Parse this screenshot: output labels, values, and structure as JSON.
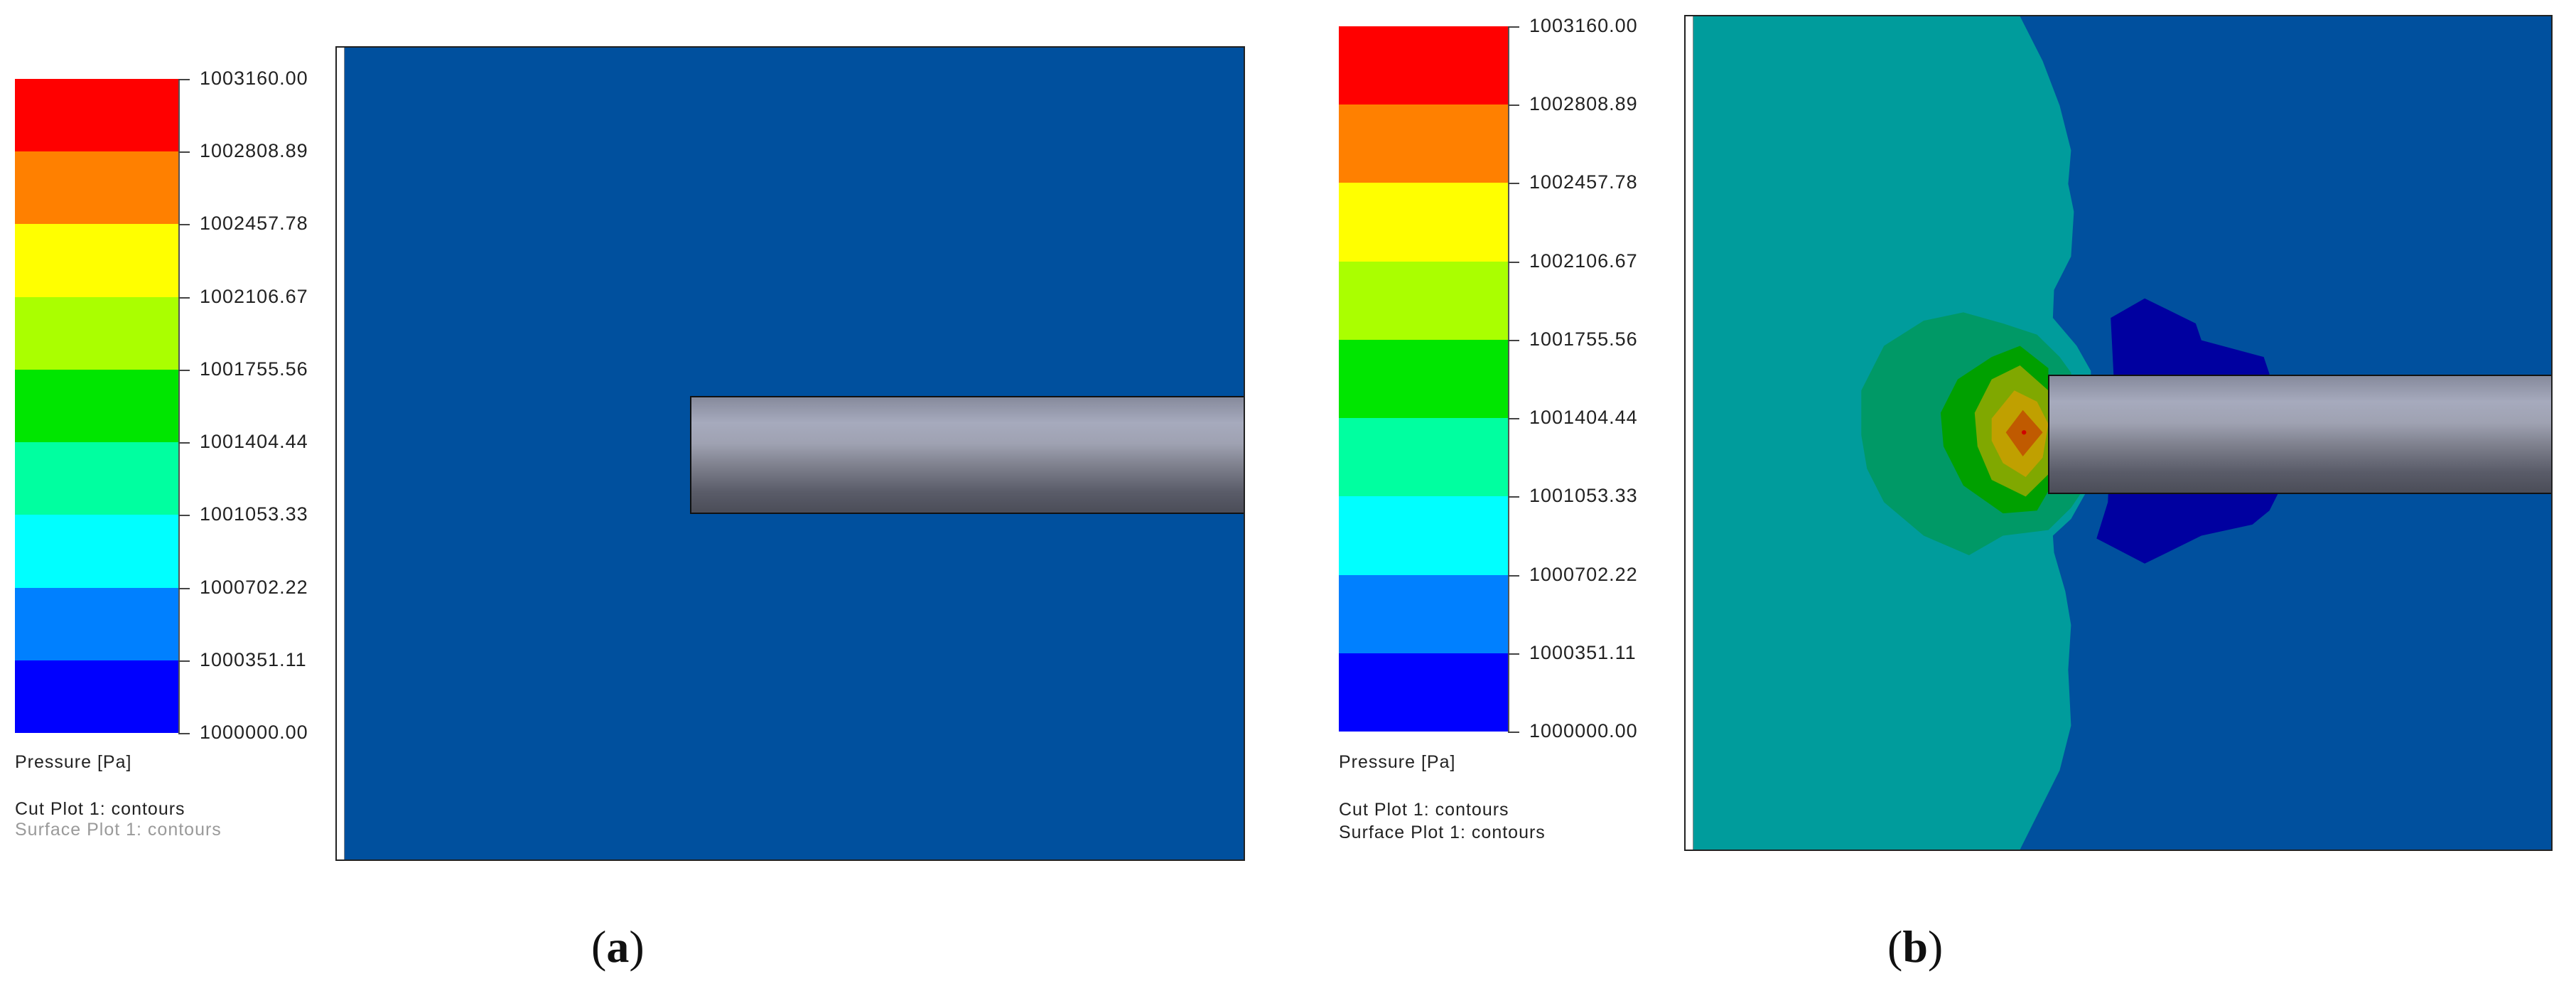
{
  "legend": {
    "colors": [
      "#ff0000",
      "#ff8000",
      "#ffff00",
      "#aaff00",
      "#00e600",
      "#00ffa0",
      "#00ffff",
      "#0080ff",
      "#0000ff"
    ],
    "ticks": [
      "1003160.00",
      "1002808.89",
      "1002457.78",
      "1002106.67",
      "1001755.56",
      "1001404.44",
      "1001053.33",
      "1000702.22",
      "1000351.11",
      "1000000.00"
    ],
    "unit_label": "Pressure [Pa]"
  },
  "panel_a": {
    "cut_plot": "Cut Plot 1: contours",
    "surface_plot": "Surface Plot 1: contours",
    "caption_open": "(",
    "caption_letter": "a",
    "caption_close": ")"
  },
  "panel_b": {
    "cut_plot": "Cut Plot 1: contours",
    "surface_plot": "Surface Plot 1: contours",
    "caption_open": "(",
    "caption_letter": "b",
    "caption_close": ")"
  },
  "field_colors": {
    "background": "#00509e",
    "teal": "#009c9c",
    "deep_blue": "#0000a0",
    "green": "#009966"
  }
}
